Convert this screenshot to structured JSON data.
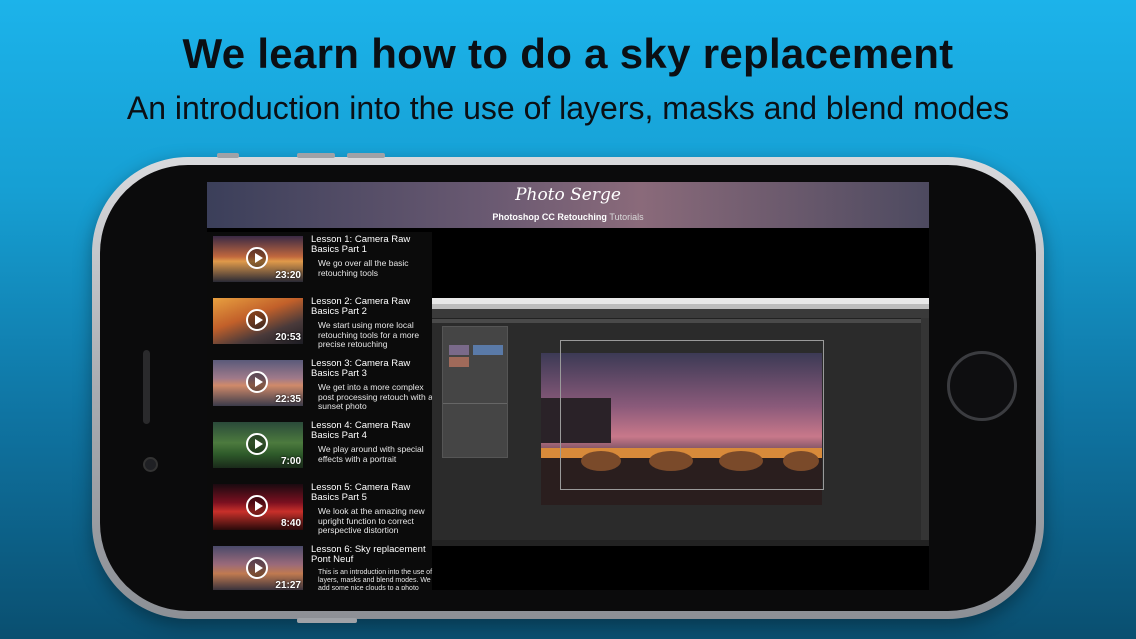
{
  "headline": "We learn how to do a sky replacement",
  "subline": "An introduction into the use of layers, masks and blend modes",
  "app": {
    "logo": "Photo Serge",
    "subtitle_bold": "Photoshop CC Retouching",
    "subtitle_light": "Tutorials"
  },
  "lessons": [
    {
      "title": "Lesson 1: Camera Raw Basics Part 1",
      "description": "We go over all the basic retouching tools",
      "duration": "23:20"
    },
    {
      "title": "Lesson 2: Camera Raw Basics Part 2",
      "description": "We start using more local retouching tools for a more precise retouching",
      "duration": "20:53"
    },
    {
      "title": "Lesson 3: Camera Raw Basics Part 3",
      "description": "We get into a more complex post processing retouch with a sunset photo",
      "duration": "22:35"
    },
    {
      "title": "Lesson 4: Camera Raw Basics Part 4",
      "description": "We play around with special effects with a portrait",
      "duration": "7:00"
    },
    {
      "title": "Lesson 5: Camera Raw Basics Part 5",
      "description": "We look at the amazing new upright function to correct perspective distortion",
      "duration": "8:40"
    },
    {
      "title": "Lesson 6: Sky replacement Pont Neuf",
      "description": "This is an introduction into the use of layers, masks and blend modes. We add some nice clouds to a photo",
      "duration": "21:27"
    }
  ],
  "colors": {
    "background_top": "#1cb3ea",
    "background_bottom": "#0a4f70",
    "phone_frame": "#a9acb1",
    "screen": "#000000"
  },
  "icons": [
    "play-icon"
  ]
}
